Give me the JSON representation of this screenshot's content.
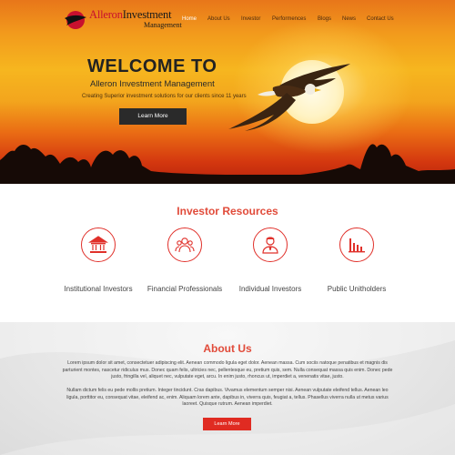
{
  "brand": {
    "name_part1": "Alleron",
    "name_part2": "Investment",
    "name_line2": "Management"
  },
  "nav": {
    "items": [
      {
        "label": "Home",
        "active": true
      },
      {
        "label": "About Us",
        "active": false
      },
      {
        "label": "Investor",
        "active": false
      },
      {
        "label": "Performences",
        "active": false
      },
      {
        "label": "Blogs",
        "active": false
      },
      {
        "label": "News",
        "active": false
      },
      {
        "label": "Contact Us",
        "active": false
      }
    ]
  },
  "hero": {
    "heading": "WELCOME TO",
    "subheading": "Alleron Investment Management",
    "tagline": "Creating Superior investment solutions for our clients since 11 years",
    "button_label": "Learn More"
  },
  "resources": {
    "title": "Investor Resources",
    "items": [
      {
        "label": "Institutional Investors",
        "icon": "bank-building-icon"
      },
      {
        "label": "Financial Professionals",
        "icon": "professionals-group-icon"
      },
      {
        "label": "Individual Investors",
        "icon": "businessman-icon"
      },
      {
        "label": "Public Unitholders",
        "icon": "bar-chart-icon"
      }
    ]
  },
  "about": {
    "title": "About Us",
    "paragraph1": "Lorem ipsum dolor sit amet, consectetuer adipiscing elit. Aenean commodo ligula eget dolor. Aenean massa. Cum sociis natoque penatibus et magnis dis parturient montes, nascetur ridiculus mus. Donec quam felis, ultricies nec, pellentesque eu, pretium quis, sem. Nulla consequat massa quis enim. Donec pede justo, fringilla vel, aliquet nec, vulputate eget, arcu. In enim justo, rhoncus ut, imperdiet a, venenatis vitae, justo.",
    "paragraph2": "Nullam dictum felis eu pede mollis pretium. Integer tincidunt. Cras dapibus. Vivamus elementum semper nisi. Aenean vulputate eleifend tellus. Aenean leo ligula, porttitor eu, consequat vitae, eleifend ac, enim. Aliquam lorem ante, dapibus in, viverra quis, feugiat a, tellus. Phasellus viverra nulla ut metus varius laoreet. Quisque rutrum. Aenean imperdiet.",
    "button_label": "Learn More"
  },
  "colors": {
    "accent_red": "#e02b22",
    "title_red": "#e14b3a",
    "dark_button": "#2a2a2a"
  }
}
